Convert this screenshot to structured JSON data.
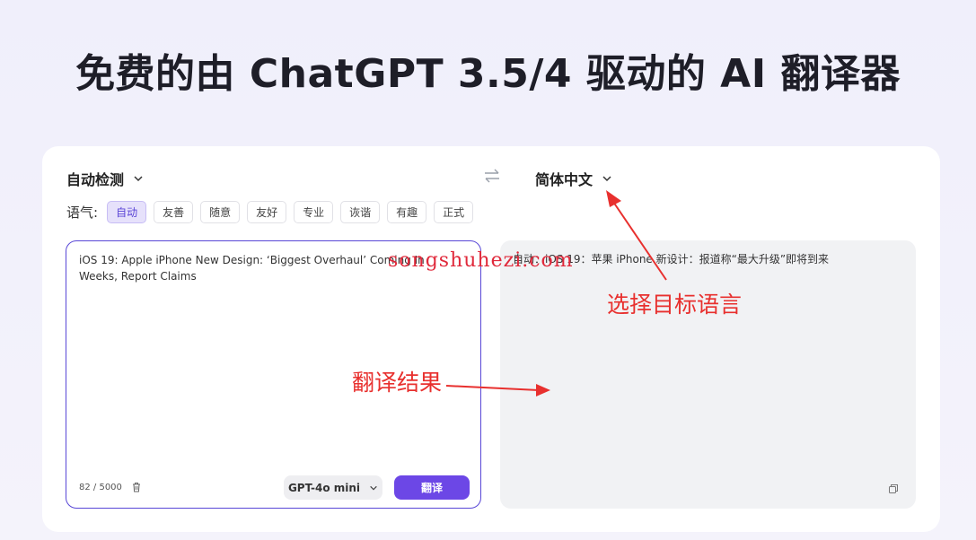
{
  "page": {
    "title": "免费的由 ChatGPT 3.5/4 驱动的 AI 翻译器"
  },
  "source_language": {
    "selected": "自动检测"
  },
  "target_language": {
    "selected": "简体中文"
  },
  "tone": {
    "label": "语气:",
    "options": [
      "自动",
      "友善",
      "随意",
      "友好",
      "专业",
      "诙谐",
      "有趣",
      "正式"
    ],
    "selected": "自动"
  },
  "source": {
    "text": "iOS 19: Apple iPhone New Design: ‘Biggest Overhaul’ Coming In Weeks, Report Claims",
    "counter": "82 / 5000"
  },
  "model": {
    "selected": "GPT-4o mini"
  },
  "translate_button": {
    "label": "翻译"
  },
  "target": {
    "text": "自动：iOS 19：苹果 iPhone 新设计：报道称“最大升级”即将到来"
  },
  "overlay": {
    "watermark": "songshuhezi.com",
    "annotation_target": "选择目标语言",
    "annotation_result": "翻译结果",
    "annotation_color": "#e8302e"
  },
  "colors": {
    "accent": "#6c47e6",
    "active_chip_bg": "#e6e1fb",
    "source_border": "#5847d6"
  },
  "icons": {
    "dropdown": "chevron-down-icon",
    "swap": "swap-arrows-icon",
    "delete": "trash-icon",
    "copy": "copy-icon"
  }
}
